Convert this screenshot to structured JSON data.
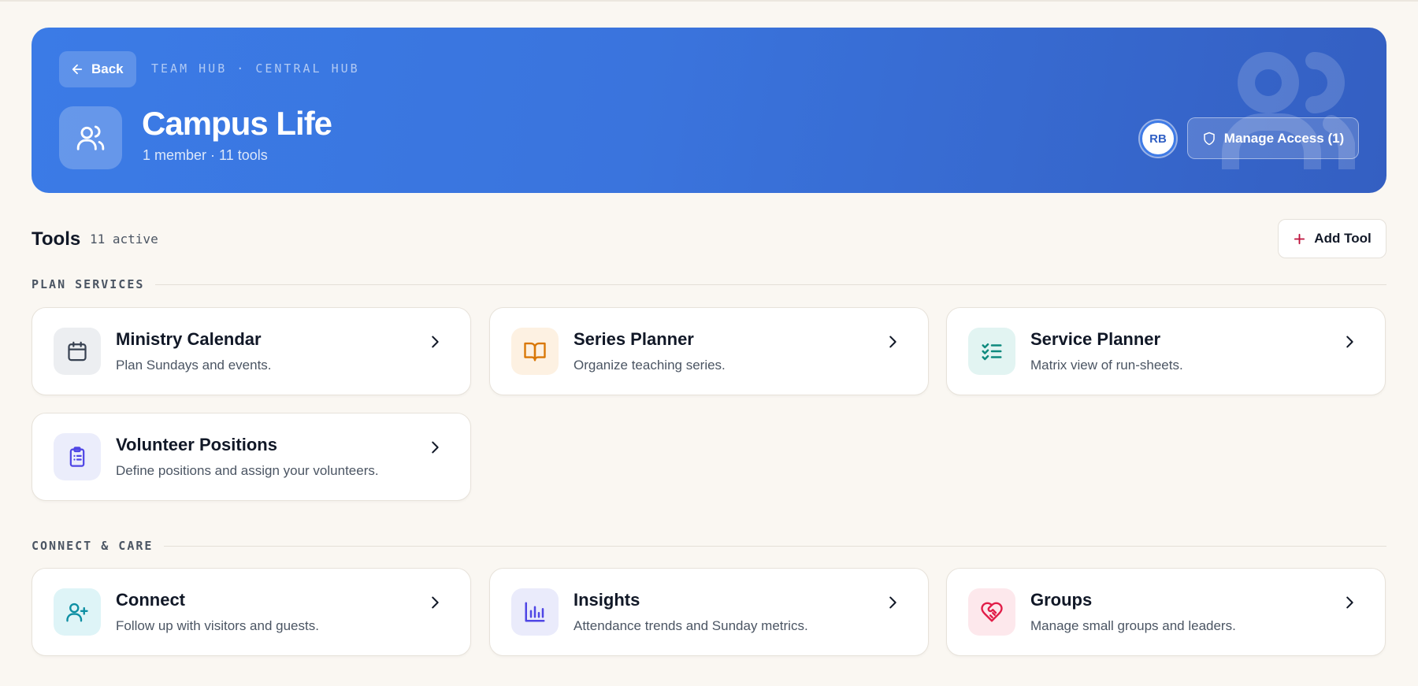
{
  "header": {
    "back_label": "Back",
    "breadcrumb": "TEAM HUB · CENTRAL HUB",
    "team_name": "Campus Life",
    "team_meta": "1 member · 11 tools",
    "avatar_initials": "RB",
    "manage_access_label": "Manage Access (1)",
    "accent_color": "#3b7be6"
  },
  "tools": {
    "title": "Tools",
    "count_label": "11 active",
    "add_label": "Add Tool"
  },
  "sections": [
    {
      "label": "PLAN SERVICES",
      "cards": [
        {
          "title": "Ministry Calendar",
          "description": "Plan Sundays and events.",
          "icon": "calendar-icon",
          "color": "#374151"
        },
        {
          "title": "Series Planner",
          "description": "Organize teaching series.",
          "icon": "book-icon",
          "color": "#d97706"
        },
        {
          "title": "Service Planner",
          "description": "Matrix view of run-sheets.",
          "icon": "checklist-icon",
          "color": "#0f8a7e"
        },
        {
          "title": "Volunteer Positions",
          "description": "Define positions and assign your volunteers.",
          "icon": "clipboard-icon",
          "color": "#4f46e5"
        }
      ]
    },
    {
      "label": "CONNECT & CARE",
      "cards": [
        {
          "title": "Connect",
          "description": "Follow up with visitors and guests.",
          "icon": "user-plus-icon",
          "color": "#0e8fa3"
        },
        {
          "title": "Insights",
          "description": "Attendance trends and Sunday metrics.",
          "icon": "bar-chart-icon",
          "color": "#4f46e5"
        },
        {
          "title": "Groups",
          "description": "Manage small groups and leaders.",
          "icon": "heart-handshake-icon",
          "color": "#e11d48"
        }
      ]
    }
  ]
}
